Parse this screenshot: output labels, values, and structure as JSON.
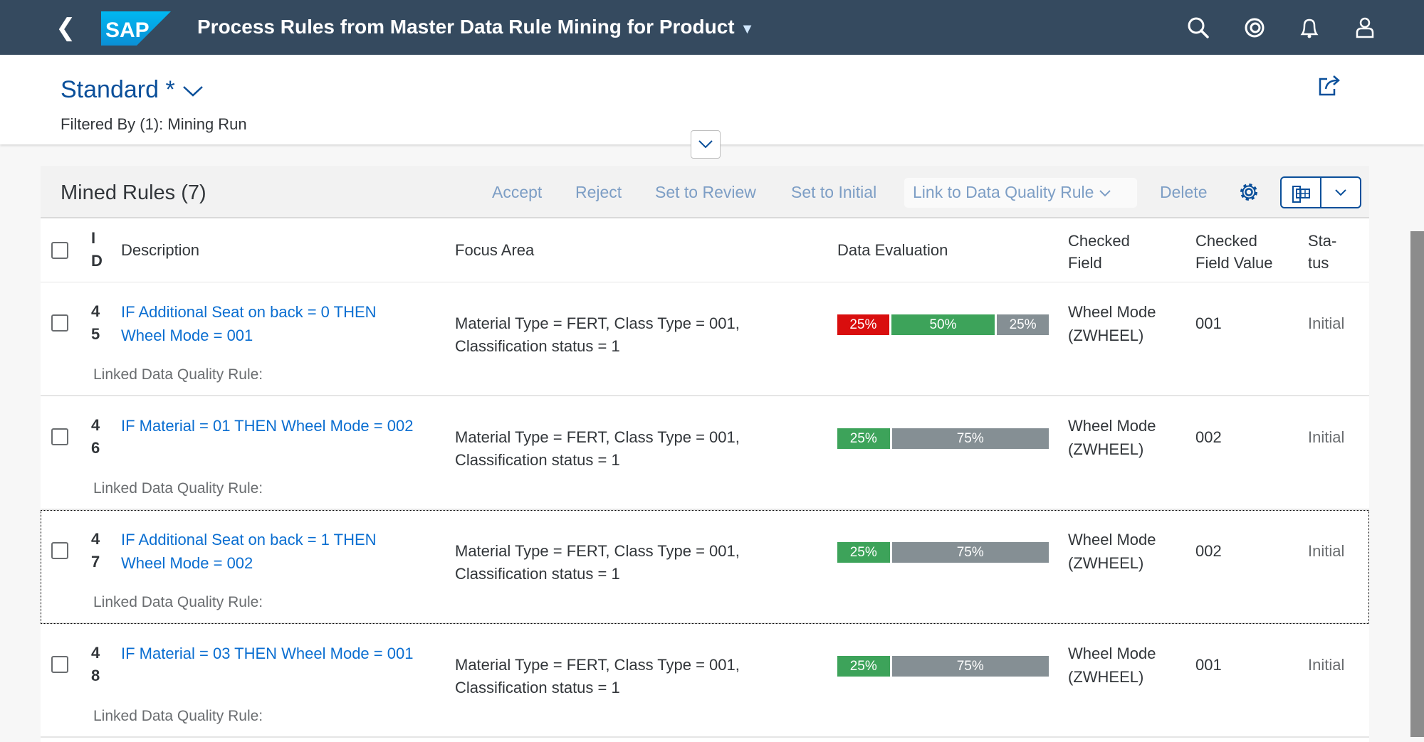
{
  "shell": {
    "title": "Process Rules from Master Data Rule Mining for Product",
    "logo_text": "SAP",
    "icons": [
      "back-icon",
      "search-icon",
      "copilot-icon",
      "notification-bell-icon",
      "user-icon"
    ]
  },
  "header": {
    "variant": "Standard *",
    "filtered": "Filtered By (1): Mining Run"
  },
  "toolbar": {
    "title": "Mined Rules (7)",
    "accept": "Accept",
    "reject": "Reject",
    "review": "Set to Review",
    "initial": "Set to Initial",
    "link": "Link to Data Quality Rule",
    "delete": "Delete"
  },
  "columns": {
    "id": "I D",
    "description": "Description",
    "focus": "Focus Area",
    "eval": "Data Evaluation",
    "field": "Checked Field",
    "value": "Checked Field Value",
    "status": "Sta- tus"
  },
  "colors": {
    "shell": "#354a5f",
    "link": "#0a6ed1",
    "red": "#d90e0e",
    "green": "#3da35a",
    "grey": "#858f94"
  },
  "linked_label": "Linked Data Quality Rule:",
  "rows": [
    {
      "id": "4 5",
      "description": "IF Additional Seat on back = 0 THEN Wheel Mode = 001",
      "focus": "Material Type = FERT, Class Type = 001, Classification status = 1",
      "eval": [
        {
          "label": "25%",
          "value": 25,
          "color": "red"
        },
        {
          "label": "50%",
          "value": 50,
          "color": "green"
        },
        {
          "label": "25%",
          "value": 25,
          "color": "grey"
        }
      ],
      "field": "Wheel Mode (ZWHEEL)",
      "value": "001",
      "status": "Initial"
    },
    {
      "id": "4 6",
      "description": "IF Material = 01 THEN Wheel Mode = 002",
      "focus": "Material Type = FERT, Class Type = 001, Classification status = 1",
      "eval": [
        {
          "label": "25%",
          "value": 25,
          "color": "green"
        },
        {
          "label": "75%",
          "value": 75,
          "color": "grey"
        }
      ],
      "field": "Wheel Mode (ZWHEEL)",
      "value": "002",
      "status": "Initial"
    },
    {
      "id": "4 7",
      "description": "IF Additional Seat on back = 1 THEN Wheel Mode = 002",
      "focus": "Material Type = FERT, Class Type = 001, Classification status = 1",
      "eval": [
        {
          "label": "25%",
          "value": 25,
          "color": "green"
        },
        {
          "label": "75%",
          "value": 75,
          "color": "grey"
        }
      ],
      "field": "Wheel Mode (ZWHEEL)",
      "value": "002",
      "status": "Initial"
    },
    {
      "id": "4 8",
      "description": "IF Material = 03 THEN Wheel Mode = 001",
      "focus": "Material Type = FERT, Class Type = 001, Classification status = 1",
      "eval": [
        {
          "label": "25%",
          "value": 25,
          "color": "green"
        },
        {
          "label": "75%",
          "value": 75,
          "color": "grey"
        }
      ],
      "field": "Wheel Mode (ZWHEEL)",
      "value": "001",
      "status": "Initial"
    }
  ]
}
